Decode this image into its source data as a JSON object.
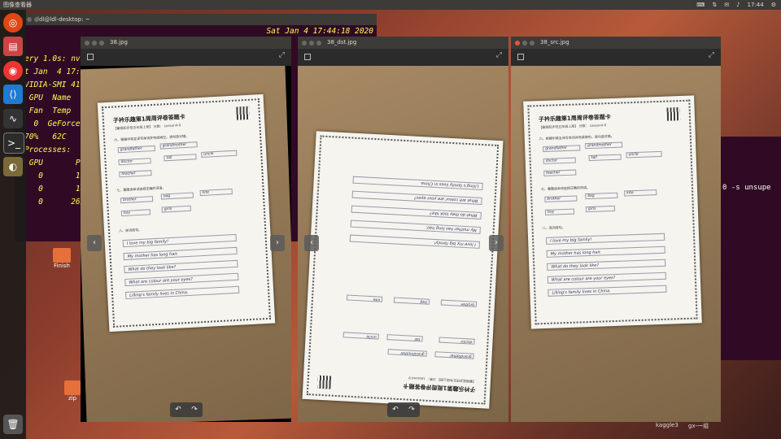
{
  "top_panel": {
    "app_name": "图像查看器",
    "time": "17:44"
  },
  "terminal": {
    "title": "ldl@ldl-desktop: ~",
    "lines": [
      "ery 1.0s: nvidia-smi",
      "t Jan  4 17:4",
      "VIDIA-SMI 41",
      " GPU  Name",
      " Fan  Temp  Pe",
      "",
      "  0  GeForce",
      "70%   62C",
      "",
      "Processes:",
      " GPU       PI",
      "",
      "   0       10",
      "   0       18",
      "   0      262"
    ],
    "right_text": "Sat Jan  4 17:44:18 2020"
  },
  "bg_terminal": {
    "text": "0 -s unsupe"
  },
  "desktop": {
    "finish_label": "Finish",
    "item2_label": "zip"
  },
  "taskbar": {
    "label1": "kaggle3",
    "label2": "gx-一组"
  },
  "viewers": [
    {
      "title": "38.jpg"
    },
    {
      "title": "38_dst.jpg"
    },
    {
      "title": "38_src.jpg"
    }
  ],
  "paper": {
    "title": "子衿乐趣第1周周评卷答题卡",
    "subtitle": "【暑假起步班五年级上册】 分数：  Lesson4-9",
    "section1": "六、根据中英互译写单词并完成填空。请勾选对错。",
    "words1": [
      "grandfather",
      "grandmother",
      "doctor",
      "tall",
      "uncle",
      "teacher"
    ],
    "section2": "七、看图读单词选择正确的词语。",
    "words2": [
      "brother",
      "bag",
      "kite",
      "boy",
      "girls"
    ],
    "section3": "八、连词成句。",
    "sentences": [
      "I love my big family!",
      "My mother has long hair.",
      "What do they look like?",
      "What are colour are your eyes?",
      "Lilling's family lives in China."
    ]
  },
  "icons": {
    "prev": "chevron-left-icon",
    "next": "chevron-right-icon",
    "rotate_left": "rotate-left-icon",
    "rotate_right": "rotate-right-icon"
  }
}
